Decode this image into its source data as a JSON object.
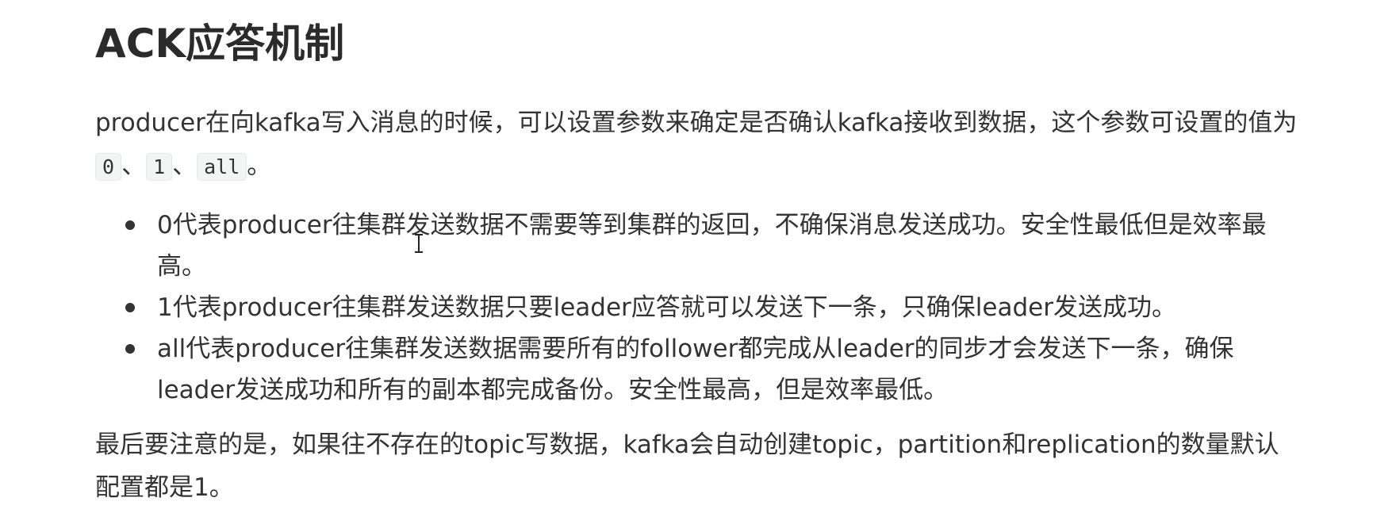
{
  "heading": "ACK应答机制",
  "intro": {
    "text_before": "producer在向kafka写入消息的时候，可以设置参数来确定是否确认kafka接收到数据，这个参数可设置的值为",
    "code_values": [
      "0",
      "1",
      "all"
    ],
    "separator": "、",
    "end": "。"
  },
  "bullets": [
    "0代表producer往集群发送数据不需要等到集群的返回，不确保消息发送成功。安全性最低但是效率最高。",
    "1代表producer往集群发送数据只要leader应答就可以发送下一条，只确保leader发送成功。",
    "all代表producer往集群发送数据需要所有的follower都完成从leader的同步才会发送下一条，确保leader发送成功和所有的副本都完成备份。安全性最高，但是效率最低。"
  ],
  "footer_paragraph": "最后要注意的是，如果往不存在的topic写数据，kafka会自动创建topic，partition和replication的数量默认配置都是1。",
  "cursor_icon": "text-cursor-icon"
}
